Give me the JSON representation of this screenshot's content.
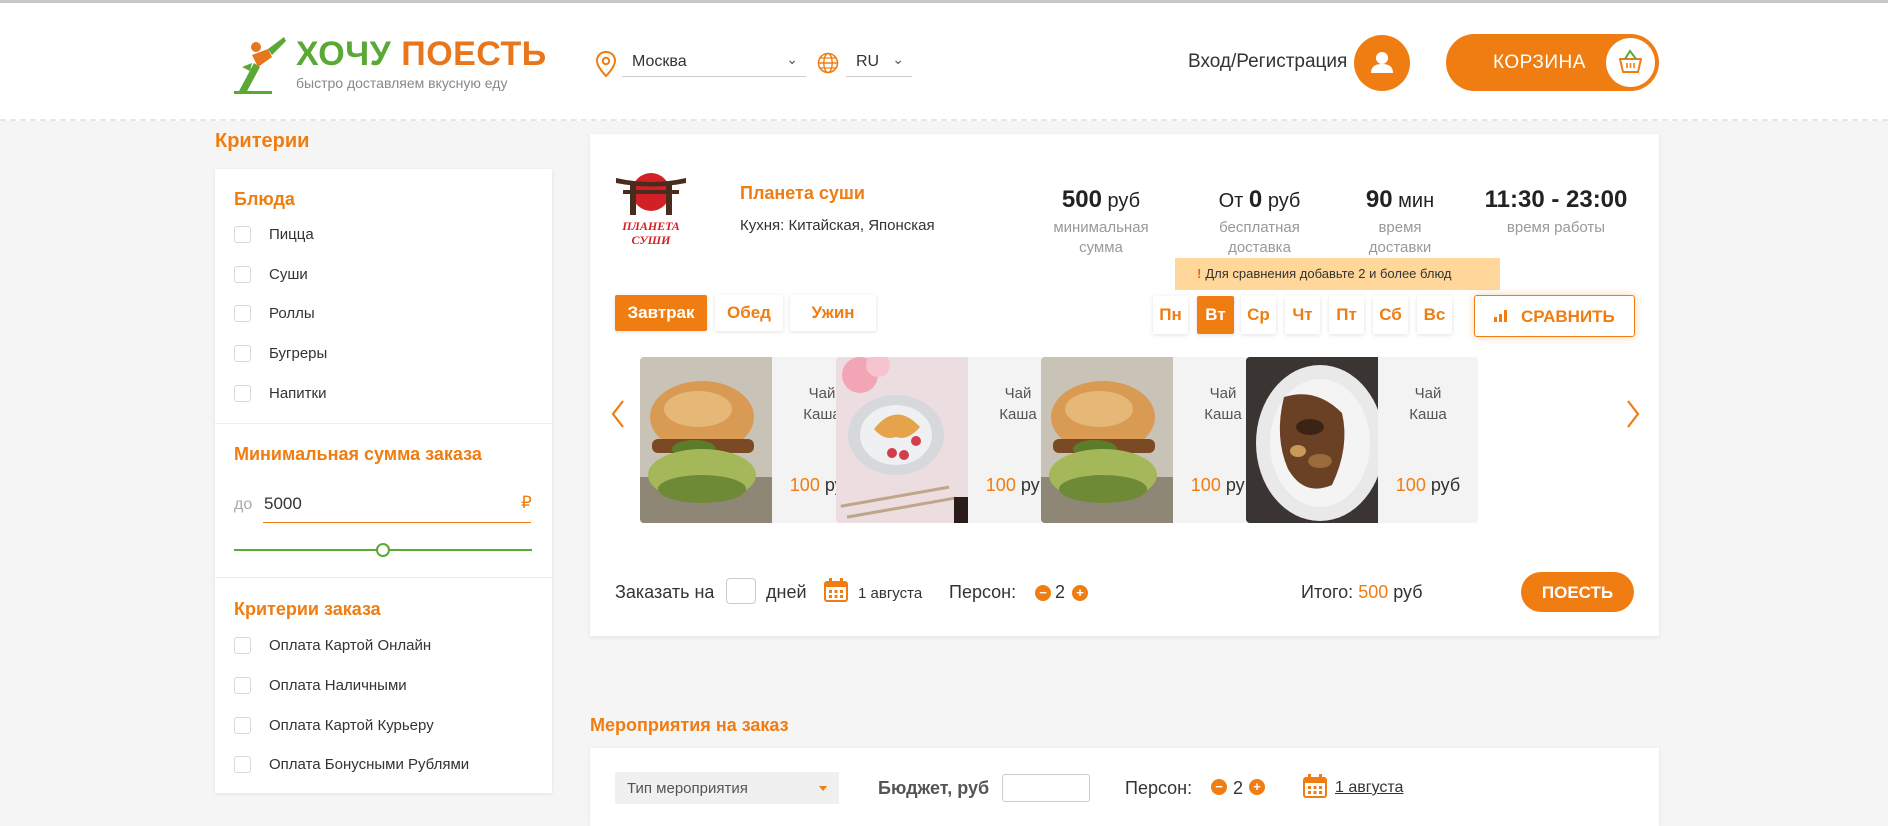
{
  "header": {
    "logo": {
      "name_part1": "ХОЧУ",
      "name_part2": "ПОЕСТЬ",
      "tagline": "быстро доставляем вкусную еду"
    },
    "city": "Москва",
    "language": "RU",
    "login_label": "Вход/Регистрация",
    "cart_label": "КОРЗИНА",
    "colors": {
      "accent": "#ef7d12",
      "green": "#5aa835"
    }
  },
  "sidebar": {
    "title": "Критерии",
    "dishes": {
      "heading": "Блюда",
      "items": [
        "Пицца",
        "Суши",
        "Роллы",
        "Бугреры",
        "Напитки"
      ]
    },
    "min_sum": {
      "heading": "Минимальная сумма заказа",
      "prefix": "до",
      "value": "5000",
      "currency": "₽",
      "slider_fraction": 0.5
    },
    "order_criteria": {
      "heading": "Критерии заказа",
      "items": [
        "Оплата Картой Онлайн",
        "Оплата Наличными",
        "Оплата Картой Курьеру",
        "Оплата Бонусными Рублями"
      ]
    }
  },
  "restaurant": {
    "logo_text": "ПЛАНЕТА СУШИ",
    "name": "Планета суши",
    "cuisine": "Кухня: Китайская, Японская",
    "stats": {
      "min_sum": {
        "value": "500",
        "unit": "руб",
        "label": "минимальная сумма"
      },
      "free_delivery": {
        "prefix": "От",
        "value": "0",
        "unit": "руб",
        "label": "бесплатная доставка"
      },
      "delivery_time": {
        "value": "90",
        "unit": "мин",
        "label": "время доставки"
      },
      "hours": {
        "value": "11:30 - 23:00",
        "label": "время работы"
      }
    },
    "tooltip": {
      "icon": "!",
      "text": "Для сравнения добавьте 2 и более блюд"
    },
    "meal_tabs": [
      "Завтрак",
      "Обед",
      "Ужин"
    ],
    "active_meal": "Завтрак",
    "days": [
      "Пн",
      "Вт",
      "Ср",
      "Чт",
      "Пт",
      "Сб",
      "Вс"
    ],
    "active_day": "Вт",
    "compare_label": "СРАВНИТЬ",
    "dishes": [
      {
        "line1": "Чай",
        "line2": "Каша",
        "price": "100",
        "currency": "руб",
        "photo": "burger"
      },
      {
        "line1": "Чай",
        "line2": "Каша",
        "price": "100",
        "currency": "руб",
        "photo": "croissant"
      },
      {
        "line1": "Чай",
        "line2": "Каша",
        "price": "100",
        "currency": "руб",
        "photo": "burger"
      },
      {
        "line1": "Чай",
        "line2": "Каша",
        "price": "100",
        "currency": "руб",
        "photo": "grilled-plate"
      }
    ],
    "order": {
      "order_for": "Заказать на",
      "days_label": "дней",
      "date": "1 августа",
      "persons_label": "Персон:",
      "persons": "2",
      "total_label": "Итого:",
      "total_value": "500",
      "total_currency": "руб",
      "eat_button": "ПОЕСТЬ"
    }
  },
  "events": {
    "title": "Мероприятия на заказ",
    "type_placeholder": "Тип мероприятия",
    "budget_label": "Бюджет, руб",
    "persons_label": "Персон:",
    "persons": "2",
    "date": "1 августа"
  }
}
